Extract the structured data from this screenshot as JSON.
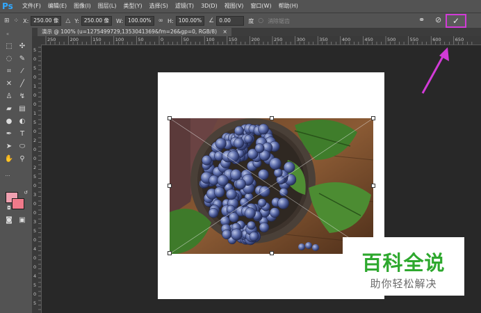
{
  "app": {
    "logo": "Ps"
  },
  "menu": [
    "文件(F)",
    "编辑(E)",
    "图像(I)",
    "图层(L)",
    "类型(Y)",
    "选择(S)",
    "滤镜(T)",
    "3D(D)",
    "视图(V)",
    "窗口(W)",
    "帮助(H)"
  ],
  "options": {
    "x_label": "X:",
    "x_value": "250.00 像",
    "y_label": "Y:",
    "y_value": "250.00 像",
    "w_label": "W:",
    "w_value": "100.00%",
    "h_label": "H:",
    "h_value": "100.00%",
    "angle_value": "0.00",
    "angle_unit": "度",
    "interp_label": "消除锯齿"
  },
  "document_tab": {
    "title": "演示 @ 100% (u=1275499729,1353041369&fm=26&gp=0, RGB/8)",
    "close": "×"
  },
  "ruler_top_ticks": [
    "250",
    "200",
    "150",
    "100",
    "50",
    "0",
    "50",
    "100",
    "150",
    "200",
    "250",
    "300",
    "350",
    "400",
    "450",
    "500",
    "550",
    "600",
    "650"
  ],
  "ruler_left_ticks": [
    "5",
    "0",
    "5",
    "0",
    "1",
    "0",
    "0",
    "1",
    "5",
    "0",
    "2",
    "0",
    "0",
    "2",
    "5",
    "0",
    "3",
    "0",
    "0",
    "3",
    "5",
    "0",
    "4",
    "0",
    "0",
    "4",
    "5",
    "0",
    "5"
  ],
  "colors": {
    "foreground": "#f0a0b0",
    "background": "#f07a8a",
    "highlight": "#d23bd7",
    "watermark_green": "#2ea82e"
  },
  "watermark": {
    "title": "百科全说",
    "subtitle": "助你轻松解决"
  },
  "icons": {
    "commit": "✓",
    "cancel": "⊘",
    "warp": "⚭"
  }
}
